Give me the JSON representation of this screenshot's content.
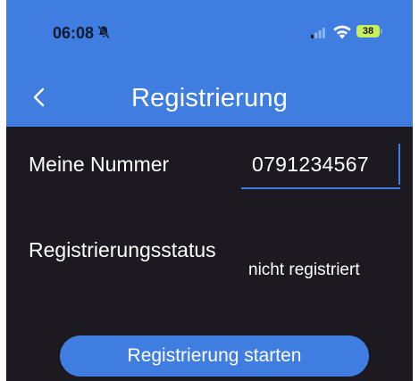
{
  "status_bar": {
    "time": "06:08",
    "battery": "38",
    "icons": [
      "bell-slash-icon",
      "signal-icon",
      "wifi-icon",
      "battery-icon"
    ]
  },
  "nav": {
    "title": "Registrierung",
    "back_icon": "chevron-left-icon"
  },
  "form": {
    "number_label": "Meine Nummer",
    "number_value": "0791234567",
    "status_label": "Registrierungsstatus",
    "status_value": "nicht registriert"
  },
  "actions": {
    "start_label": "Registrierung starten"
  },
  "colors": {
    "accent": "#3f7de0",
    "background": "#1c1a20",
    "battery": "#c8f05a"
  }
}
